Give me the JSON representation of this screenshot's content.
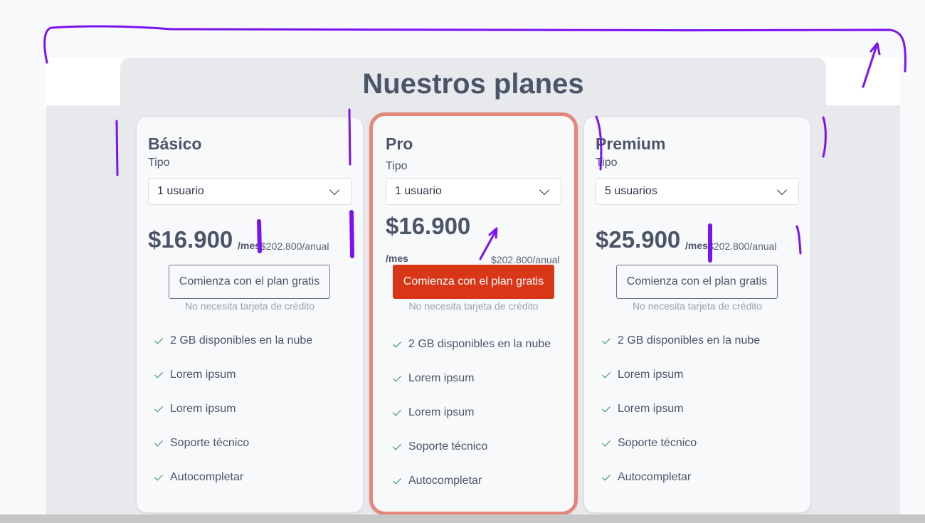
{
  "page": {
    "title": "Nuestros planes"
  },
  "plans": [
    {
      "name": "Básico",
      "type_label": "Tipo",
      "selected_option": "1 usuario",
      "price": "$16.900",
      "per": "/mes",
      "annual": "$202.800/anual",
      "cta_label": "Comienza con el plan gratis",
      "note": "No necesita tarjeta de crédito",
      "features": [
        "2 GB disponibles en la nube",
        "Lorem ipsum",
        "Lorem ipsum",
        "Soporte técnico",
        "Autocompletar"
      ]
    },
    {
      "name": "Pro",
      "type_label": "Tipo",
      "selected_option": "1 usuario",
      "price": "$16.900",
      "per": "/mes",
      "annual": "$202.800/anual",
      "cta_label": "Comienza con el plan gratis",
      "note": "No necesita tarjeta de crédito",
      "features": [
        "2 GB disponibles en la nube",
        "Lorem ipsum",
        "Lorem ipsum",
        "Soporte técnico",
        "Autocompletar"
      ]
    },
    {
      "name": "Premium",
      "type_label": "Tipo",
      "selected_option": "5 usuarios",
      "price": "$25.900",
      "per": "/mes",
      "annual": "$202.800/anual",
      "cta_label": "Comienza con el plan gratis",
      "note": "No necesita tarjeta de crédito",
      "features": [
        "2 GB disponibles en la nube",
        "Lorem ipsum",
        "Lorem ipsum",
        "Soporte técnico",
        "Autocompletar"
      ]
    }
  ],
  "colors": {
    "accent": "#d93618",
    "featured_border": "#e4867a",
    "check": "#2f8f5b",
    "annotation": "#7b12f0"
  }
}
